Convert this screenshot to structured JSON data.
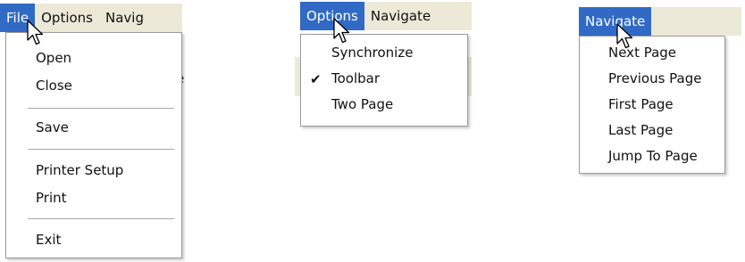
{
  "file_panel": {
    "menubar": [
      "File",
      "Options",
      "Navig"
    ],
    "items": [
      "Open",
      "Close",
      "Save",
      "Printer Setup",
      "Print",
      "Exit"
    ],
    "behind_char": "e"
  },
  "options_panel": {
    "menubar": [
      "Options",
      "Navigate"
    ],
    "items": [
      {
        "label": "Synchronize",
        "checked": false
      },
      {
        "label": "Toolbar",
        "checked": true
      },
      {
        "label": "Two Page",
        "checked": false
      }
    ],
    "check_glyph": "✔"
  },
  "navigate_panel": {
    "menubar": [
      "Navigate"
    ],
    "items": [
      "Next Page",
      "Previous Page",
      "First Page",
      "Last Page",
      "Jump To Page"
    ]
  },
  "colors": {
    "menubar_bg": "#ECE9D8",
    "highlight": "#316AC5",
    "menu_bg": "#FFFFFF",
    "border": "#9A9A9A"
  }
}
